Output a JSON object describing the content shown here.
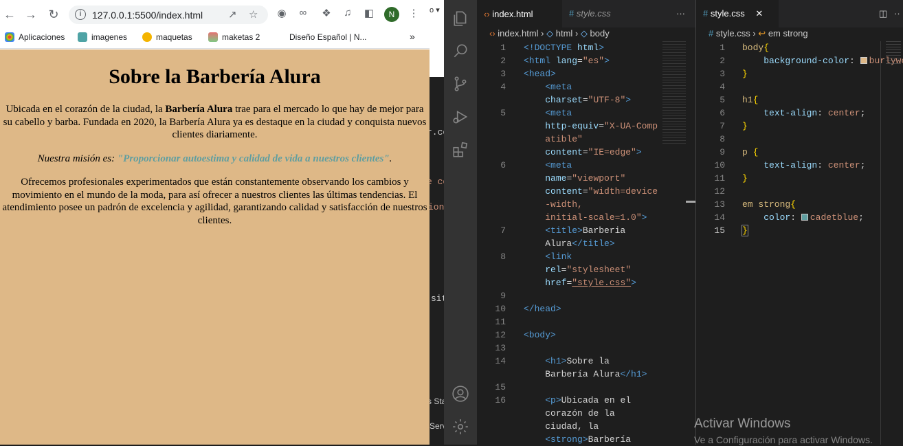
{
  "browser": {
    "url": "127.0.0.1:5500/index.html",
    "avatar_letter": "N",
    "bookmarks": [
      {
        "label": "Aplicaciones",
        "color": "#4285f4"
      },
      {
        "label": "imagenes",
        "color": "#4fa3a5"
      },
      {
        "label": "maquetas",
        "color": "#f4b400"
      },
      {
        "label": "maketas 2",
        "color": "#e57373"
      },
      {
        "label": "Diseño Español | N...",
        "color": ""
      }
    ],
    "more_bookmarks": "»"
  },
  "page": {
    "title": "Sobre la Barbería Alura",
    "p1_before": "Ubicada en el corazón de la ciudad, la ",
    "p1_strong": "Barbería Alura",
    "p1_after": " trae para el mercado lo que hay de mejor para su cabello y barba. Fundada en 2020, la Barbería Alura ya es destaque en la ciudad y conquista nuevos clientes diariamente.",
    "p2_before": "Nuestra misión es: ",
    "p2_em": "\"Proporcionar autoestima y calidad de vida a nuestros clientes\"",
    "p2_after": ".",
    "p3": "Ofrecemos profesionales experimentados que están constantemente observando los cambios y movimiento en el mundo de la moda, para así ofrecer a nuestros clientes las últimas tendencias. El atendimiento posee un padrón de excelencia y agilidad, garantizando calidad y satisfacción de nuestros clientes.",
    "background": "#deb887",
    "highlight": "#5f9ea0"
  },
  "strip": [
    "to ▾",
    "r.co",
    "e co",
    "ion",
    "sit",
    "s Sta",
    "Serv"
  ],
  "vscode": {
    "editor1": {
      "tab_active": "index.html",
      "tab_inactive": "style.css",
      "more": "···",
      "crumb": [
        "index.html",
        "html",
        "body"
      ],
      "lines": [
        {
          "n": "1",
          "html": "<span class='tag'>&lt;!DOCTYPE</span> <span class='attr'>html</span><span class='tag'>&gt;</span>"
        },
        {
          "n": "2",
          "html": "<span class='tag'>&lt;html</span> <span class='attr'>lang</span>=<span class='str'>\"es\"</span><span class='tag'>&gt;</span>"
        },
        {
          "n": "3",
          "html": "<span class='tag'>&lt;head&gt;</span>"
        },
        {
          "n": "4",
          "html": "    <span class='tag'>&lt;meta</span>"
        },
        {
          "n": "",
          "html": "    <span class='attr'>charset</span>=<span class='str'>\"UTF-8\"</span><span class='tag'>&gt;</span>"
        },
        {
          "n": "5",
          "html": "    <span class='tag'>&lt;meta</span>"
        },
        {
          "n": "",
          "html": "    <span class='attr'>http-equiv</span>=<span class='str'>\"X-UA-Comp</span>"
        },
        {
          "n": "",
          "html": "    <span class='str'>atible\"</span>"
        },
        {
          "n": "",
          "html": "    <span class='attr'>content</span>=<span class='str'>\"IE=edge\"</span><span class='tag'>&gt;</span>"
        },
        {
          "n": "6",
          "html": "    <span class='tag'>&lt;meta</span>"
        },
        {
          "n": "",
          "html": "    <span class='attr'>name</span>=<span class='str'>\"viewport\"</span>"
        },
        {
          "n": "",
          "html": "    <span class='attr'>content</span>=<span class='str'>\"width=device</span>"
        },
        {
          "n": "",
          "html": "    <span class='str'>-width,</span>"
        },
        {
          "n": "",
          "html": "    <span class='str'>initial-scale=1.0\"</span><span class='tag'>&gt;</span>"
        },
        {
          "n": "7",
          "html": "    <span class='tag'>&lt;title&gt;</span><span class='txt'>Barberia</span>"
        },
        {
          "n": "",
          "html": "    <span class='txt'>Alura</span><span class='tag'>&lt;/title&gt;</span>"
        },
        {
          "n": "8",
          "html": "    <span class='tag'>&lt;link</span>"
        },
        {
          "n": "",
          "html": "    <span class='attr'>rel</span>=<span class='str'>\"stylesheet\"</span>"
        },
        {
          "n": "",
          "html": "    <span class='attr'>href</span>=<span class='str' style='text-decoration:underline'>\"style.css\"</span><span class='tag'>&gt;</span>"
        },
        {
          "n": "9",
          "html": ""
        },
        {
          "n": "10",
          "html": "<span class='tag'>&lt;/head&gt;</span>"
        },
        {
          "n": "11",
          "html": ""
        },
        {
          "n": "12",
          "html": "<span class='tag'>&lt;body&gt;</span>"
        },
        {
          "n": "13",
          "html": ""
        },
        {
          "n": "14",
          "html": "    <span class='tag'>&lt;h1&gt;</span><span class='txt'>Sobre la</span>"
        },
        {
          "n": "",
          "html": "    <span class='txt'>Barbería Alura</span><span class='tag'>&lt;/h1&gt;</span>"
        },
        {
          "n": "15",
          "html": ""
        },
        {
          "n": "16",
          "html": "    <span class='tag'>&lt;p&gt;</span><span class='txt'>Ubicada en el</span>"
        },
        {
          "n": "",
          "html": "    <span class='txt'>corazón de la</span>"
        },
        {
          "n": "",
          "html": "    <span class='txt'>ciudad, la</span>"
        },
        {
          "n": "",
          "html": "    <span class='tag'>&lt;strong&gt;</span><span class='txt'>Barbería</span>"
        }
      ]
    },
    "editor2": {
      "tab_active": "style.css",
      "crumb": [
        "style.css",
        "em strong"
      ],
      "lines": [
        {
          "n": "1",
          "html": "<span class='sel'>body</span><span class='brace'>{</span>"
        },
        {
          "n": "2",
          "html": "    <span class='prop'>background-color</span>: <span class='swatch' style='background:#deb887'></span><span class='val'>burlywood</span>;"
        },
        {
          "n": "3",
          "html": "<span class='brace'>}</span>"
        },
        {
          "n": "4",
          "html": ""
        },
        {
          "n": "5",
          "html": "<span class='sel'>h1</span><span class='brace'>{</span>"
        },
        {
          "n": "6",
          "html": "    <span class='prop'>text-align</span>: <span class='val'>center</span>;"
        },
        {
          "n": "7",
          "html": "<span class='brace'>}</span>"
        },
        {
          "n": "8",
          "html": ""
        },
        {
          "n": "9",
          "html": "<span class='sel'>p</span> <span class='brace'>{</span>"
        },
        {
          "n": "10",
          "html": "    <span class='prop'>text-align</span>: <span class='val'>center</span>;"
        },
        {
          "n": "11",
          "html": "<span class='brace'>}</span>"
        },
        {
          "n": "12",
          "html": ""
        },
        {
          "n": "13",
          "html": "<span class='sel'>em strong</span><span class='brace'>{</span>"
        },
        {
          "n": "14",
          "html": "    <span class='prop'>color</span>: <span class='swatch' style='background:#5f9ea0'></span><span class='val'>cadetblue</span>;"
        },
        {
          "n": "15",
          "html": "<span class='brace' style='outline:1px solid #888'>}</span>"
        }
      ],
      "current_line": "15"
    }
  },
  "watermark": {
    "line1": "Activar Windows",
    "line2": "Ve a Configuración para activar Windows."
  }
}
